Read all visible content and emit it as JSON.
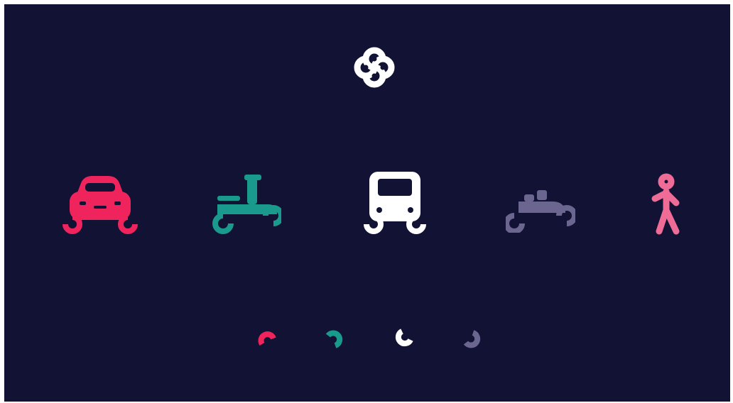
{
  "colors": {
    "background": "#121235",
    "car": "#f0245d",
    "scooter": "#1a9a8c",
    "bus": "#ffffff",
    "bike": "#6b6690",
    "walker": "#ef6c97"
  },
  "logo": {
    "icon": "knot-logo-icon"
  },
  "vehicles": [
    {
      "icon": "car-icon",
      "color": "#f0245d"
    },
    {
      "icon": "scooter-icon",
      "color": "#1a9a8c"
    },
    {
      "icon": "bus-icon",
      "color": "#ffffff"
    },
    {
      "icon": "bike-icon",
      "color": "#6b6690"
    },
    {
      "icon": "pedestrian-icon",
      "color": "#ef6c97"
    }
  ],
  "progress_dots": [
    {
      "icon": "dot-arc-red-icon",
      "color": "#f0245d"
    },
    {
      "icon": "dot-arc-teal-icon",
      "color": "#1a9a8c"
    },
    {
      "icon": "dot-arc-white-icon",
      "color": "#ffffff"
    },
    {
      "icon": "dot-arc-grey-icon",
      "color": "#6b6690"
    }
  ]
}
